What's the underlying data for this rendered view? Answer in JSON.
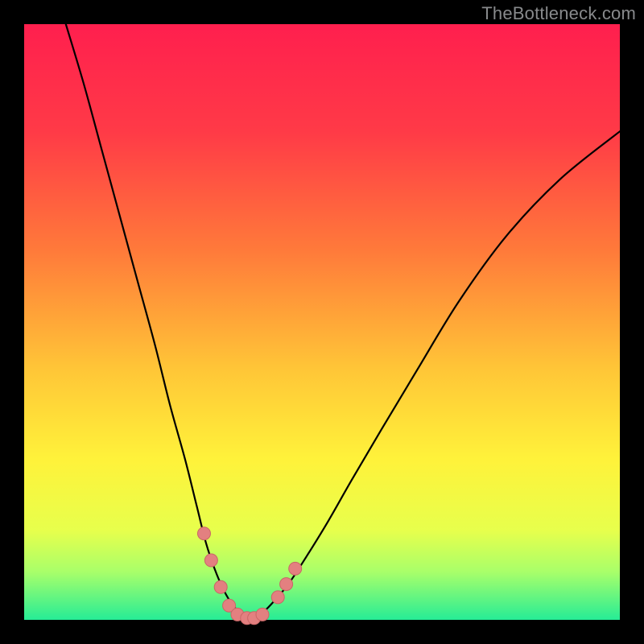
{
  "watermark": "TheBottleneck.com",
  "chart_data": {
    "type": "line",
    "title": "",
    "xlabel": "",
    "ylabel": "",
    "xlim": [
      0,
      100
    ],
    "ylim": [
      0,
      100
    ],
    "gradient_stops": [
      {
        "offset": 0,
        "color": "#ff1f4e"
      },
      {
        "offset": 18,
        "color": "#ff3a47"
      },
      {
        "offset": 38,
        "color": "#ff7a3a"
      },
      {
        "offset": 58,
        "color": "#ffc637"
      },
      {
        "offset": 73,
        "color": "#fff23a"
      },
      {
        "offset": 85,
        "color": "#e7ff4c"
      },
      {
        "offset": 92,
        "color": "#a8ff6a"
      },
      {
        "offset": 100,
        "color": "#26ec96"
      }
    ],
    "series": [
      {
        "name": "left-curve",
        "x": [
          7,
          10,
          13,
          16,
          19,
          22,
          24.5,
          27,
          29,
          30.5,
          32,
          33.5,
          35,
          36.5,
          38
        ],
        "y": [
          100,
          90,
          79,
          68,
          57,
          46,
          36,
          27,
          19,
          13,
          8.5,
          5,
          2.5,
          1,
          0.2
        ]
      },
      {
        "name": "right-curve",
        "x": [
          38,
          40,
          42,
          44.5,
          47.5,
          51,
          55,
          60,
          66,
          73,
          81,
          90,
          100
        ],
        "y": [
          0.2,
          1.2,
          3.2,
          6.2,
          10.8,
          16.5,
          23.5,
          32,
          42,
          53.5,
          64.5,
          74,
          82
        ]
      }
    ],
    "markers": {
      "name": "highlight-points",
      "color": "#e38080",
      "radius_px": 8,
      "points": [
        {
          "x": 30.2,
          "y": 14.5
        },
        {
          "x": 31.4,
          "y": 10.0
        },
        {
          "x": 33.0,
          "y": 5.5
        },
        {
          "x": 34.4,
          "y": 2.4
        },
        {
          "x": 35.8,
          "y": 0.9
        },
        {
          "x": 37.4,
          "y": 0.3
        },
        {
          "x": 38.6,
          "y": 0.3
        },
        {
          "x": 40.0,
          "y": 0.9
        },
        {
          "x": 42.6,
          "y": 3.8
        },
        {
          "x": 44.0,
          "y": 6.0
        },
        {
          "x": 45.5,
          "y": 8.6
        }
      ]
    }
  }
}
